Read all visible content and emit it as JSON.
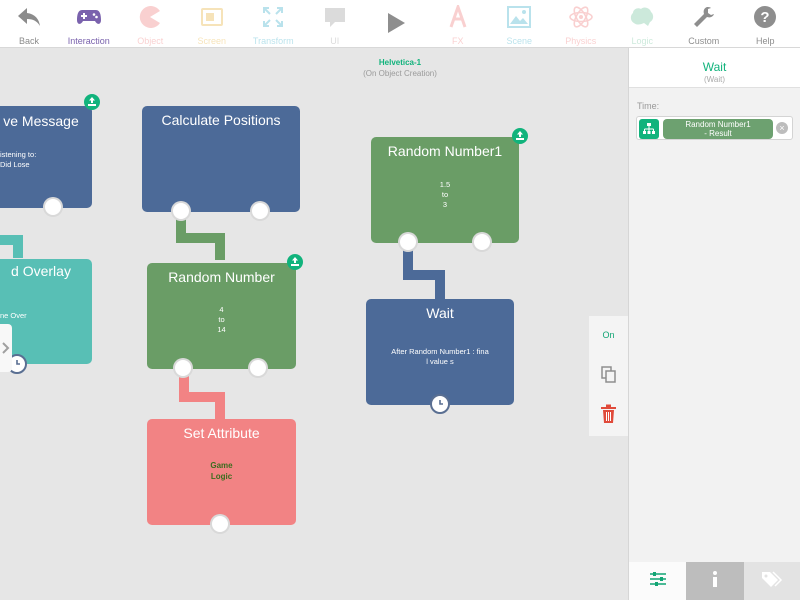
{
  "toolbar": {
    "items": [
      {
        "label": "Back",
        "icon": "back-arrow-icon"
      },
      {
        "label": "Interaction",
        "icon": "gamepad-icon"
      },
      {
        "label": "Object",
        "icon": "pacman-icon"
      },
      {
        "label": "Screen",
        "icon": "screen-icon"
      },
      {
        "label": "Transform",
        "icon": "transform-arrows-icon"
      },
      {
        "label": "UI",
        "icon": "speech-bubble-icon"
      },
      {
        "label": "",
        "icon": "play-icon"
      },
      {
        "label": "FX",
        "icon": "fx-icon"
      },
      {
        "label": "Scene",
        "icon": "scene-image-icon"
      },
      {
        "label": "Physics",
        "icon": "atom-icon"
      },
      {
        "label": "Logic",
        "icon": "brain-icon"
      },
      {
        "label": "Custom",
        "icon": "wrench-icon"
      },
      {
        "label": "Help",
        "icon": "help-icon"
      }
    ]
  },
  "canvas": {
    "object_name": "Helvetica-1",
    "object_event": "(On Object Creation)"
  },
  "nodes": {
    "receive": {
      "title": "ve Message",
      "body1": "istening to:",
      "body2": "Did Lose"
    },
    "overlay": {
      "title": "d Overlay",
      "body1": "ne Over"
    },
    "calc": {
      "title": "Calculate Positions"
    },
    "rand": {
      "title": "Random Number",
      "line1": "4",
      "line2": "to",
      "line3": "14"
    },
    "setattr": {
      "title": "Set Attribute",
      "line1": "Game",
      "line2": "Logic"
    },
    "rand1": {
      "title": "Random Number1",
      "line1": "1.5",
      "line2": "to",
      "line3": "3"
    },
    "wait": {
      "title": "Wait",
      "line1": "After Random Number1 : fina",
      "line2": "l value s"
    }
  },
  "actions": {
    "on_label": "On"
  },
  "panel": {
    "title": "Wait",
    "subtitle": "(Wait)",
    "field_label": "Time:",
    "field_value_line1": "Random Number1",
    "field_value_line2": "- Result"
  },
  "panel_tabs": [
    "sliders-icon",
    "info-icon",
    "tag-icon"
  ],
  "colors": {
    "blue": "#4c6a98",
    "green": "#6a9d66",
    "teal": "#58bfb5",
    "red": "#f28384",
    "accent": "#11b37c"
  }
}
